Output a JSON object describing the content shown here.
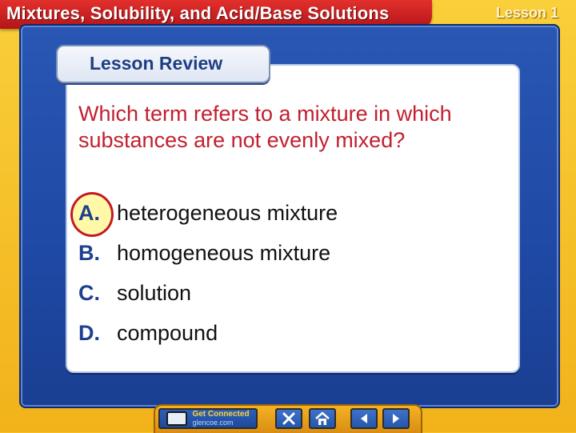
{
  "header": {
    "title": "Mixtures, Solubility, and Acid/Base Solutions",
    "lesson": "Lesson 1"
  },
  "review": {
    "label": "Lesson Review"
  },
  "question": {
    "text": "Which term refers to a mixture in which substances are not evenly mixed?"
  },
  "options": [
    {
      "letter": "A.",
      "text": "heterogeneous mixture",
      "selected": true
    },
    {
      "letter": "B.",
      "text": "homogeneous mixture"
    },
    {
      "letter": "C.",
      "text": "solution"
    },
    {
      "letter": "D.",
      "text": "compound"
    }
  ],
  "nav": {
    "connect_line1": "Get Connected",
    "connect_line2": "glencoe.com",
    "close_icon": "close-icon",
    "home_icon": "home-icon",
    "prev_icon": "arrow-left-icon",
    "next_icon": "arrow-right-icon"
  },
  "colors": {
    "title_red": "#c21f2f",
    "panel_blue": "#2a57b4",
    "frame_gold": "#f2b21a"
  }
}
